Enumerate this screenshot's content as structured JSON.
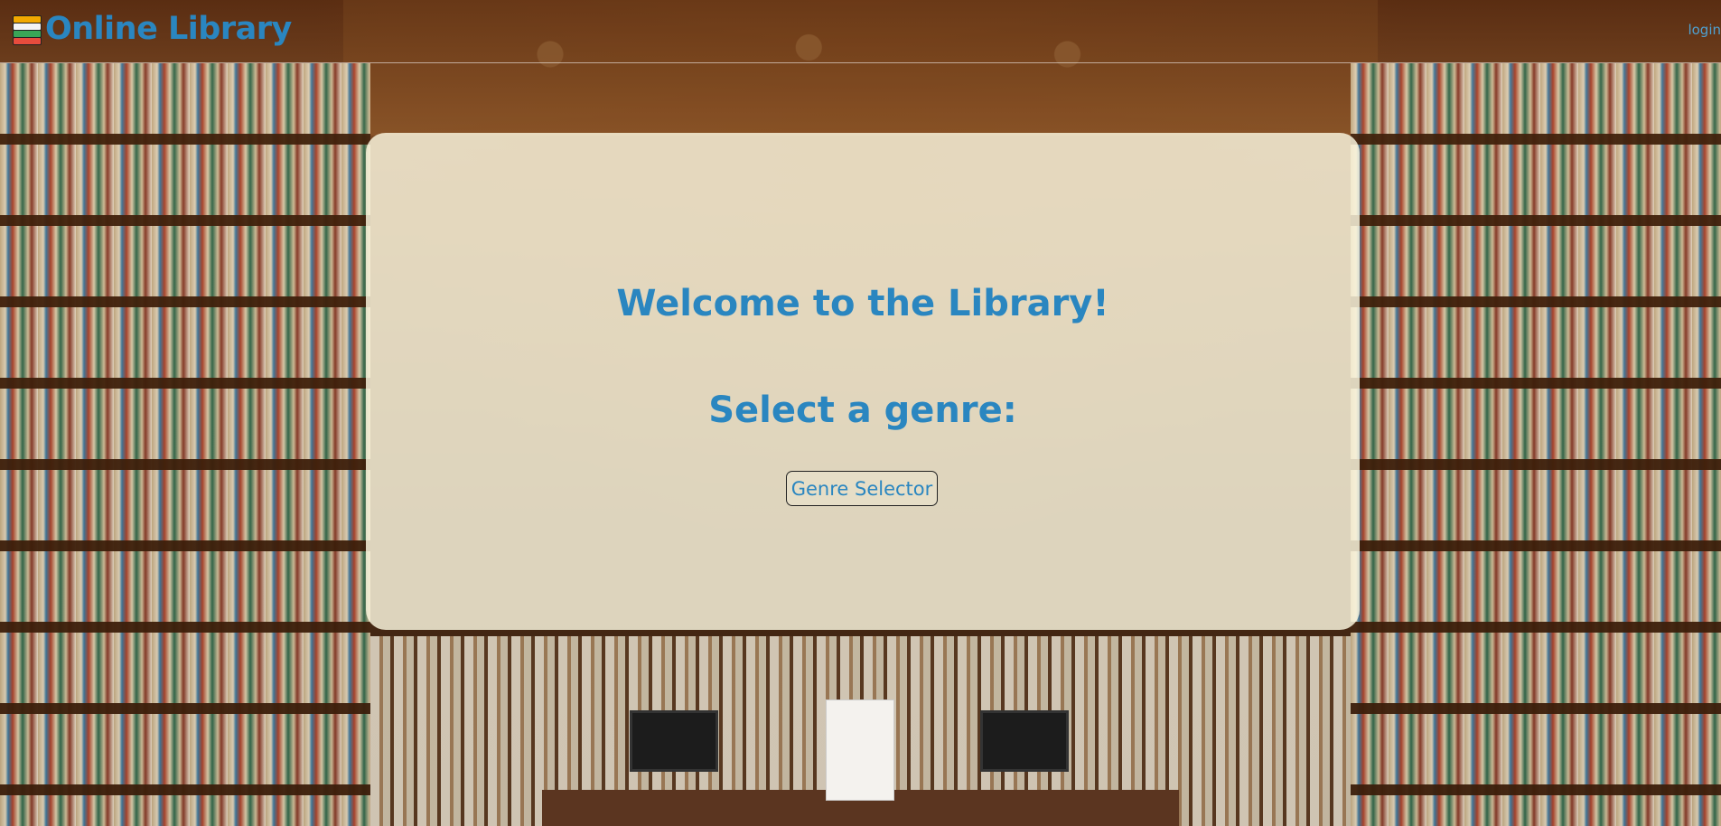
{
  "header": {
    "app_title": "Online Library",
    "logo_icon": "books-stack-icon",
    "login_label": "login"
  },
  "main": {
    "welcome_heading": "Welcome to the Library!",
    "genre_prompt": "Select a genre:",
    "genre_button_label": "Genre Selector"
  },
  "colors": {
    "accent": "#2a86c0",
    "panel_background": "#faf6de",
    "link": "#4fa1d1"
  }
}
